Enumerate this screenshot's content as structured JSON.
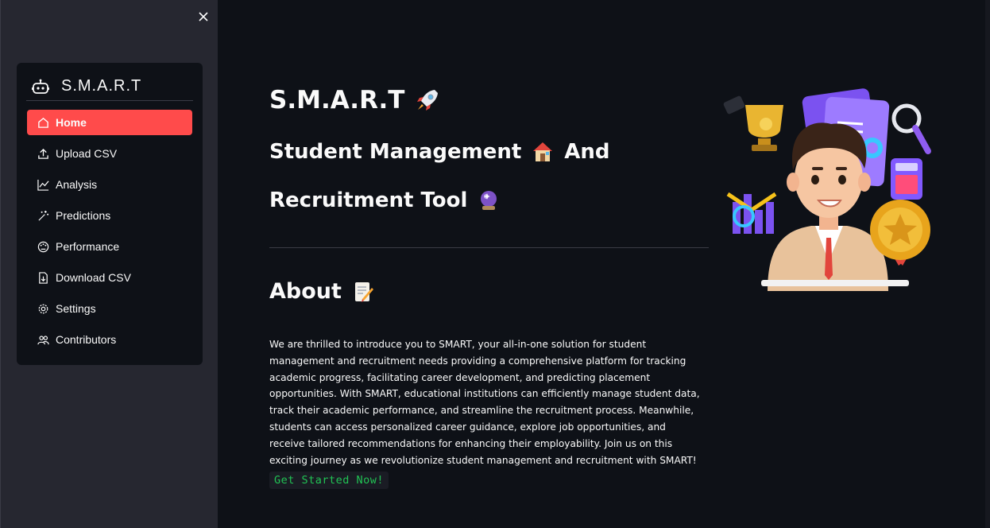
{
  "sidebar": {
    "close_icon": "close-icon",
    "brand": "S.M.A.R.T",
    "items": [
      {
        "label": "Home",
        "icon": "home-icon",
        "active": true
      },
      {
        "label": "Upload CSV",
        "icon": "upload-icon"
      },
      {
        "label": "Analysis",
        "icon": "chart-line-icon"
      },
      {
        "label": "Predictions",
        "icon": "magic-wand-icon"
      },
      {
        "label": "Performance",
        "icon": "palette-gauge-icon"
      },
      {
        "label": "Download CSV",
        "icon": "file-download-icon"
      },
      {
        "label": "Settings",
        "icon": "gear-icon"
      },
      {
        "label": "Contributors",
        "icon": "people-icon"
      }
    ]
  },
  "main": {
    "title": "S.M.A.R.T",
    "title_emoji": "rocket-icon",
    "subtitle_line1": "Student Management",
    "subtitle_line1_emoji": "house-icon",
    "subtitle_line1_suffix": "And",
    "subtitle_line2": "Recruitment Tool",
    "subtitle_line2_emoji": "crystal-ball-icon",
    "about_heading": "About",
    "about_emoji": "memo-icon",
    "about_text": "We are thrilled to introduce you to SMART, your all-in-one solution for student management and recruitment needs providing a comprehensive platform for tracking academic progress, facilitating career development, and predicting placement opportunities. With SMART, educational institutions can efficiently manage student data, track their academic performance, and streamline the recruitment process. Meanwhile, students can access personalized career guidance, explore job opportunities, and receive tailored recommendations for enhancing their employability. Join us on this exciting journey as we revolutionize student management and recruitment with SMART!",
    "cta": "Get Started Now!"
  },
  "colors": {
    "background": "#0e1117",
    "sidebar": "#262730",
    "accent": "#ff4b4b",
    "cta_text": "#21c354"
  }
}
